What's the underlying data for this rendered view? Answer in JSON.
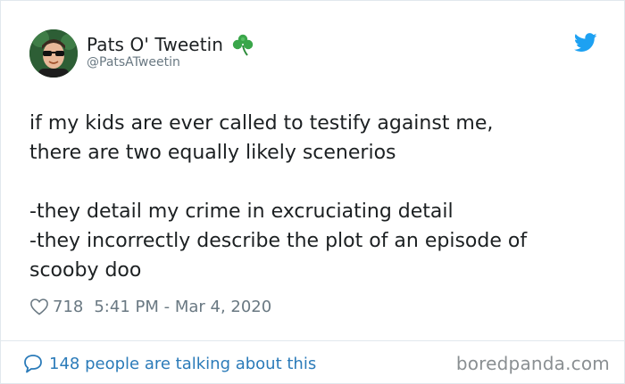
{
  "author": {
    "display_name": "Pats O' Tweetin",
    "handle": "@PatsATweetin",
    "avatar_icon": "avatar-sunglasses",
    "name_emoji_icon": "shamrock-icon"
  },
  "tweet": {
    "lines": [
      "if my kids are ever called to testify against me,",
      "there are two equally likely scenerios",
      "",
      "-they detail my crime in excruciating detail",
      "-they incorrectly describe the plot of an episode of",
      "scooby doo"
    ]
  },
  "meta": {
    "likes": "718",
    "timestamp": "5:41 PM - Mar 4, 2020"
  },
  "footer": {
    "conversation_link": "148 people are talking about this",
    "watermark": "boredpanda.com"
  },
  "colors": {
    "twitter_blue": "#1da1f2",
    "link_blue": "#2b7bb9",
    "muted_gray": "#697882",
    "text": "#1c2022",
    "clover_green": "#3aa64a"
  }
}
